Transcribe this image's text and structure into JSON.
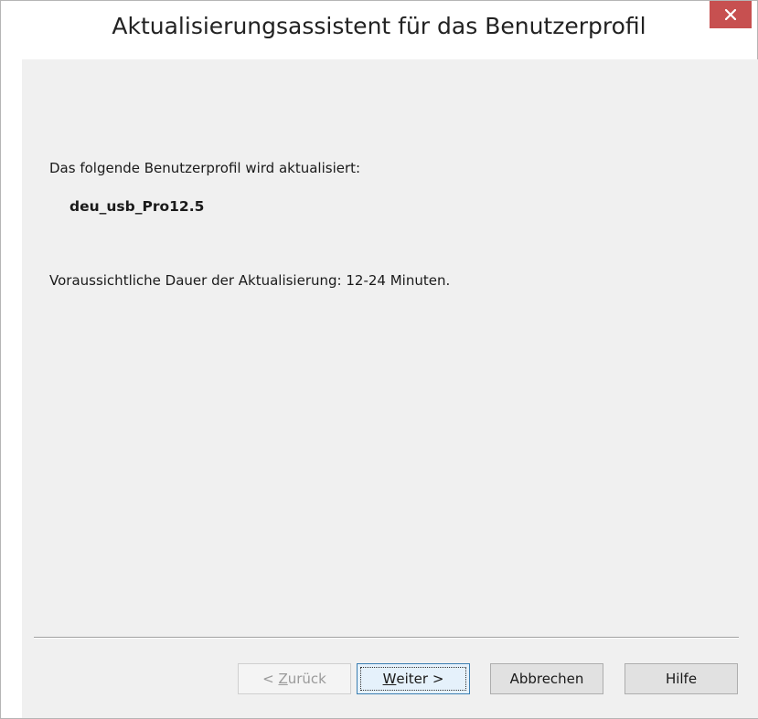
{
  "window": {
    "title": "Aktualisierungsassistent für das Benutzerprofil",
    "close_icon": "close-icon"
  },
  "content": {
    "intro": "Das folgende Benutzerprofil wird aktualisiert:",
    "profile_name": "deu_usb_Pro12.5",
    "duration": "Voraussichtliche Dauer der Aktualisierung: 12-24 Minuten."
  },
  "buttons": {
    "back": {
      "prefix": "< ",
      "accel": "Z",
      "rest": "urück",
      "enabled": false
    },
    "next": {
      "accel": "W",
      "rest": "eiter >",
      "focused": true
    },
    "cancel": "Abbrechen",
    "help": "Hilfe"
  },
  "colors": {
    "close_button": "#c75050",
    "client_background": "#f0f0f0",
    "focused_button_border": "#3c7fb1"
  }
}
